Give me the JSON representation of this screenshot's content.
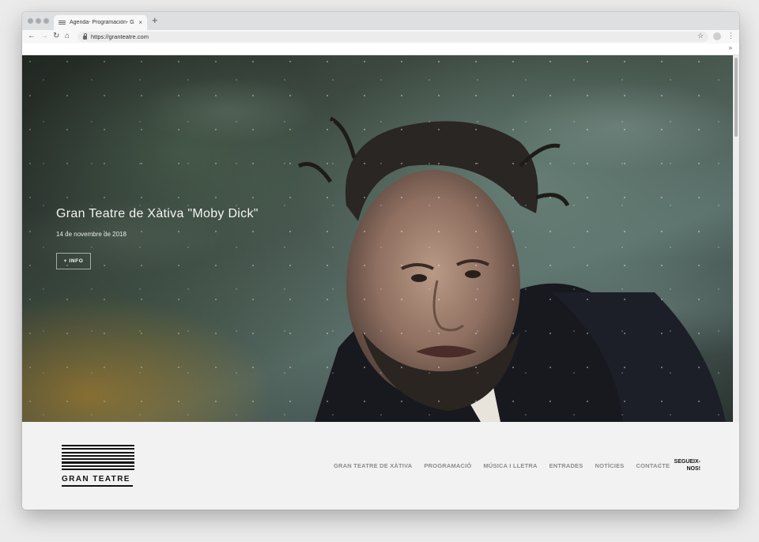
{
  "browser": {
    "tab_title": "Agenda- Programación- Gran Teatre",
    "tab_close": "×",
    "new_tab": "+",
    "url": "https://granteatre.com",
    "bookmarks_more": "»",
    "nav": {
      "back": "←",
      "forward": "→",
      "reload": "↻",
      "home": "⌂",
      "star": "☆",
      "menu": "⋮"
    },
    "colors": {
      "chrome": "#dedfe1",
      "toolbar": "#f7f7f8",
      "traffic_light": "#a9abae"
    }
  },
  "hero": {
    "title": "Gran Teatre de Xàtiva \"Moby Dick\"",
    "date": "14 de novembre de 2018",
    "info_button": "+ INFO"
  },
  "site_nav": {
    "logo_text": "GRAN TEATRE",
    "links": [
      "GRAN TEATRE DE XÀTIVA",
      "PROGRAMACIÓ",
      "MÚSICA I LLETRA",
      "ENTRADES",
      "NOTÍCIES",
      "CONTACTE"
    ],
    "divider": "/",
    "follow": "SEGUEIX-NOS!",
    "colors": {
      "link": "#8c8c8c",
      "logo": "#141414",
      "background": "#f2f2f2"
    }
  }
}
